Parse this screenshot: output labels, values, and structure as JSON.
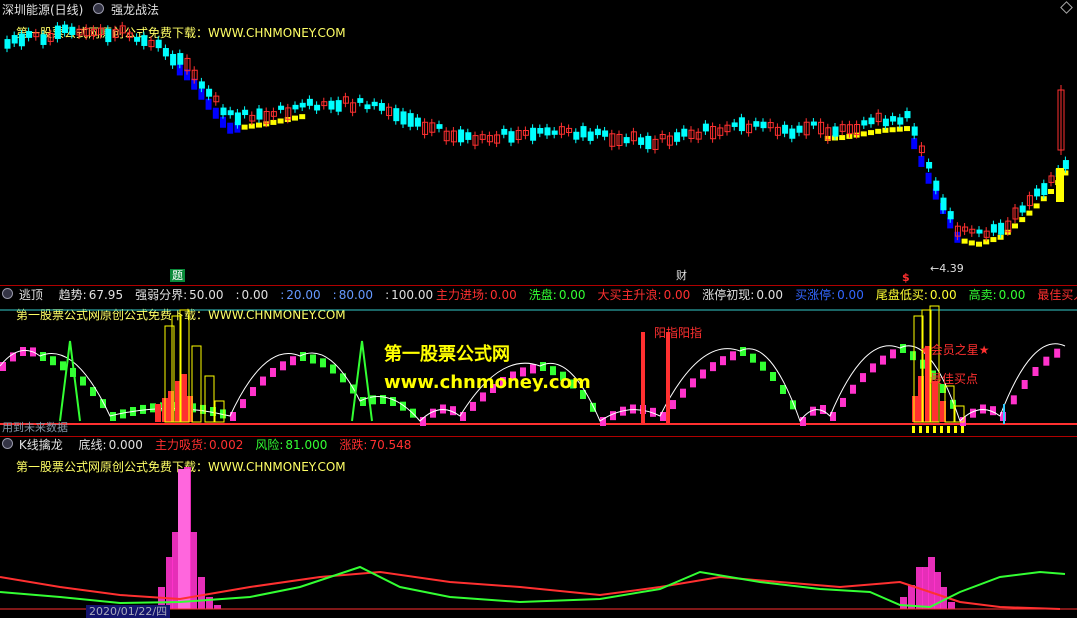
{
  "main": {
    "title": "深圳能源(日线)",
    "indicator": "强龙战法",
    "watermark": "第一股票公式网原创公式免费下载：WWW.CHNMONEY.COM",
    "low_label": "4.39",
    "marker_green": "题",
    "marker_white": "财",
    "marker_red": "$"
  },
  "panel2": {
    "name": "逃顶",
    "fields": [
      {
        "label": "趋势:",
        "value": "67.95",
        "color": "#e0e0e0"
      },
      {
        "label": "强弱分界:",
        "value": "50.00",
        "color": "#e0e0e0"
      },
      {
        "label": ":",
        "value": "0.00",
        "color": "#e0e0e0"
      },
      {
        "label": ":",
        "value": "20.00",
        "color": "#6699ff"
      },
      {
        "label": ":",
        "value": "80.00",
        "color": "#6699ff"
      },
      {
        "label": ":",
        "value": "100.00",
        "color": "#e0e0e0"
      }
    ],
    "signals": [
      {
        "label": "主力进场:",
        "value": "0.00",
        "color": "#ff3030"
      },
      {
        "label": "洗盘:",
        "value": "0.00",
        "color": "#33ff33"
      },
      {
        "label": "大买主升浪:",
        "value": "0.00",
        "color": "#ff3030"
      },
      {
        "label": "涨停初现:",
        "value": "0.00",
        "color": "#e0e0e0"
      },
      {
        "label": "买涨停:",
        "value": "0.00",
        "color": "#3366ff"
      },
      {
        "label": "尾盘低买:",
        "value": "0.00",
        "color": "#ffff33"
      },
      {
        "label": "高卖:",
        "value": "0.00",
        "color": "#33ff33"
      },
      {
        "label": "最佳买入:",
        "value": "0.00",
        "color": "#ff3030"
      }
    ],
    "watermark": "第一股票公式网原创公式免费下载：WWW.CHNMONEY.COM",
    "stamp1": "第一股票公式网",
    "stamp2": "www.chnmoney.com",
    "label_yang": "阳指阳指",
    "label_star": "★会员之星★",
    "label_buy": "最佳买点",
    "label_future": "用到未来数据"
  },
  "panel3": {
    "name": "K线擒龙",
    "fields": [
      {
        "label": "底线:",
        "value": "0.000",
        "color": "#e0e0e0"
      },
      {
        "label": "主力吸货:",
        "value": "0.002",
        "color": "#ff3030"
      },
      {
        "label": "风险:",
        "value": "81.000",
        "color": "#33ff33"
      },
      {
        "label": "涨跌:",
        "value": "70.548",
        "color": "#ff3030"
      }
    ],
    "watermark": "第一股票公式网原创公式免费下载：WWW.CHNMONEY.COM",
    "date_label": "2020/01/22/四"
  },
  "colors": {
    "bg": "#000000",
    "separator": "#b00000",
    "up": "#ff3030",
    "down": "#00ffff",
    "blue": "#0000ff",
    "yellow": "#ffff00",
    "green": "#33ff33",
    "magenta": "#ff33cc"
  }
}
